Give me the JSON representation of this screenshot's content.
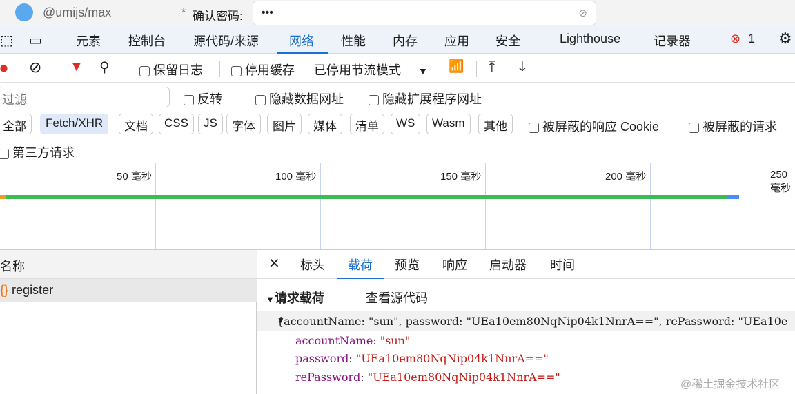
{
  "page": {
    "package": "@umijs/max",
    "required_mark": "*",
    "confirm_label": "确认密码:",
    "confirm_value": "•••"
  },
  "tabs": [
    "元素",
    "控制台",
    "源代码/来源",
    "网络",
    "性能",
    "内存",
    "应用",
    "安全",
    "Lighthouse",
    "记录器"
  ],
  "active_tab": "网络",
  "error_count": "1",
  "toolbar": {
    "preserve_log": "保留日志",
    "disable_cache": "停用缓存",
    "throttle": "已停用节流模式"
  },
  "filter": {
    "placeholder": "过滤",
    "invert": "反转",
    "hide_data_urls": "隐藏数据网址",
    "hide_ext_urls": "隐藏扩展程序网址"
  },
  "types": [
    "全部",
    "Fetch/XHR",
    "文档",
    "CSS",
    "JS",
    "字体",
    "图片",
    "媒体",
    "清单",
    "WS",
    "Wasm",
    "其他"
  ],
  "active_type": "Fetch/XHR",
  "blocked_cookies": "被屏蔽的响应 Cookie",
  "blocked_requests": "被屏蔽的请求",
  "third_party": "第三方请求",
  "timeline": {
    "ticks": [
      "50 毫秒",
      "100 毫秒",
      "150 毫秒",
      "200 毫秒",
      "250 毫秒"
    ]
  },
  "requests": {
    "header": "名称",
    "items": [
      "register"
    ]
  },
  "detail": {
    "tabs": [
      "标头",
      "载荷",
      "预览",
      "响应",
      "启动器",
      "时间"
    ],
    "active": "载荷",
    "section": "请求载荷",
    "view_source": "查看源代码",
    "summary": "{accountName: \"sun\", password: \"UEa10em80NqNip04k1NnrA==\", rePassword: \"UEa10e",
    "fields": [
      {
        "key": "accountName",
        "value": "\"sun\""
      },
      {
        "key": "password",
        "value": "\"UEa10em80NqNip04k1NnrA==\""
      },
      {
        "key": "rePassword",
        "value": "\"UEa10em80NqNip04k1NnrA==\""
      }
    ]
  },
  "watermark": "@稀土掘金技术社区"
}
